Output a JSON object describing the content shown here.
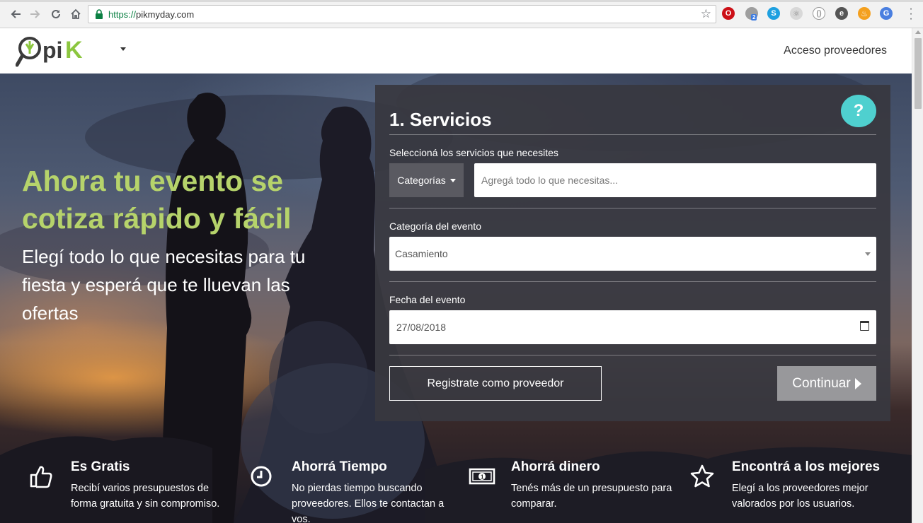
{
  "browser": {
    "url_scheme": "https://",
    "url_host": "pikmyday.com",
    "badge_count": "2"
  },
  "site": {
    "logo_text": "pik",
    "logo_prefix": "O",
    "providers_link": "Acceso proveedores"
  },
  "hero": {
    "headline": "Ahora tu evento se cotiza rápido y fácil",
    "subline": "Elegí todo lo que necesitas para tu fiesta y esperá que te lluevan las ofertas"
  },
  "form": {
    "title": "1. Servicios",
    "help_label": "?",
    "services_label": "Seleccioná los servicios que necesites",
    "categories_button": "Categorías",
    "services_placeholder": "Agregá todo lo que necesitas...",
    "event_category_label": "Categoría del evento",
    "event_category_value": "Casamiento",
    "event_date_label": "Fecha del evento",
    "event_date_value": "27/08/2018",
    "register_button": "Registrate como proveedor",
    "continue_button": "Continuar"
  },
  "features": [
    {
      "icon": "thumbs-up-icon",
      "title": "Es Gratis",
      "text": "Recibí varios presupuestos de forma gratuita y sin compromiso."
    },
    {
      "icon": "clock-icon",
      "title": "Ahorrá Tiempo",
      "text": "No pierdas tiempo buscando proveedores. Ellos te contactan a vos."
    },
    {
      "icon": "money-icon",
      "title": "Ahorrá dinero",
      "text": "Tenés más de un presupuesto para comparar."
    },
    {
      "icon": "star-icon",
      "title": "Encontrá a los mejores",
      "text": "Elegí a los proveedores mejor valorados por los usuarios."
    }
  ],
  "colors": {
    "accent_green": "#b6d36b",
    "help_teal": "#4fd0cf",
    "panel_bg": "#383840"
  }
}
